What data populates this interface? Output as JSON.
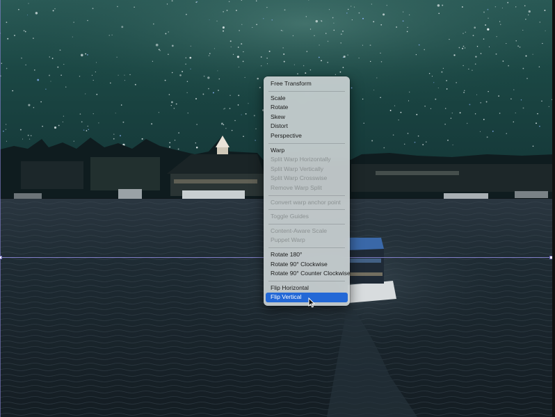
{
  "menu": {
    "items": [
      {
        "label": "Free Transform",
        "enabled": true
      },
      {
        "separator": true
      },
      {
        "label": "Scale",
        "enabled": true
      },
      {
        "label": "Rotate",
        "enabled": true
      },
      {
        "label": "Skew",
        "enabled": true
      },
      {
        "label": "Distort",
        "enabled": true
      },
      {
        "label": "Perspective",
        "enabled": true
      },
      {
        "separator": true
      },
      {
        "label": "Warp",
        "enabled": true
      },
      {
        "label": "Split Warp Horizontally",
        "enabled": false
      },
      {
        "label": "Split Warp Vertically",
        "enabled": false
      },
      {
        "label": "Split Warp Crosswise",
        "enabled": false
      },
      {
        "label": "Remove Warp Split",
        "enabled": false
      },
      {
        "separator": true
      },
      {
        "label": "Convert warp anchor point",
        "enabled": false
      },
      {
        "separator": true
      },
      {
        "label": "Toggle Guides",
        "enabled": false
      },
      {
        "separator": true
      },
      {
        "label": "Content-Aware Scale",
        "enabled": false
      },
      {
        "label": "Puppet Warp",
        "enabled": false
      },
      {
        "separator": true
      },
      {
        "label": "Rotate 180°",
        "enabled": true
      },
      {
        "label": "Rotate 90° Clockwise",
        "enabled": true
      },
      {
        "label": "Rotate 90° Counter Clockwise",
        "enabled": true
      },
      {
        "separator": true
      },
      {
        "label": "Flip Horizontal",
        "enabled": true
      },
      {
        "label": "Flip Vertical",
        "enabled": true,
        "selected": true
      }
    ]
  },
  "colors": {
    "sky": "#1d4a48",
    "water": "#1b2830",
    "menu_bg": "#ced5d6",
    "selection": "#2368d6",
    "transform_line": "#8a86d6"
  },
  "icons": {
    "cursor": "arrow-pointer-icon"
  }
}
